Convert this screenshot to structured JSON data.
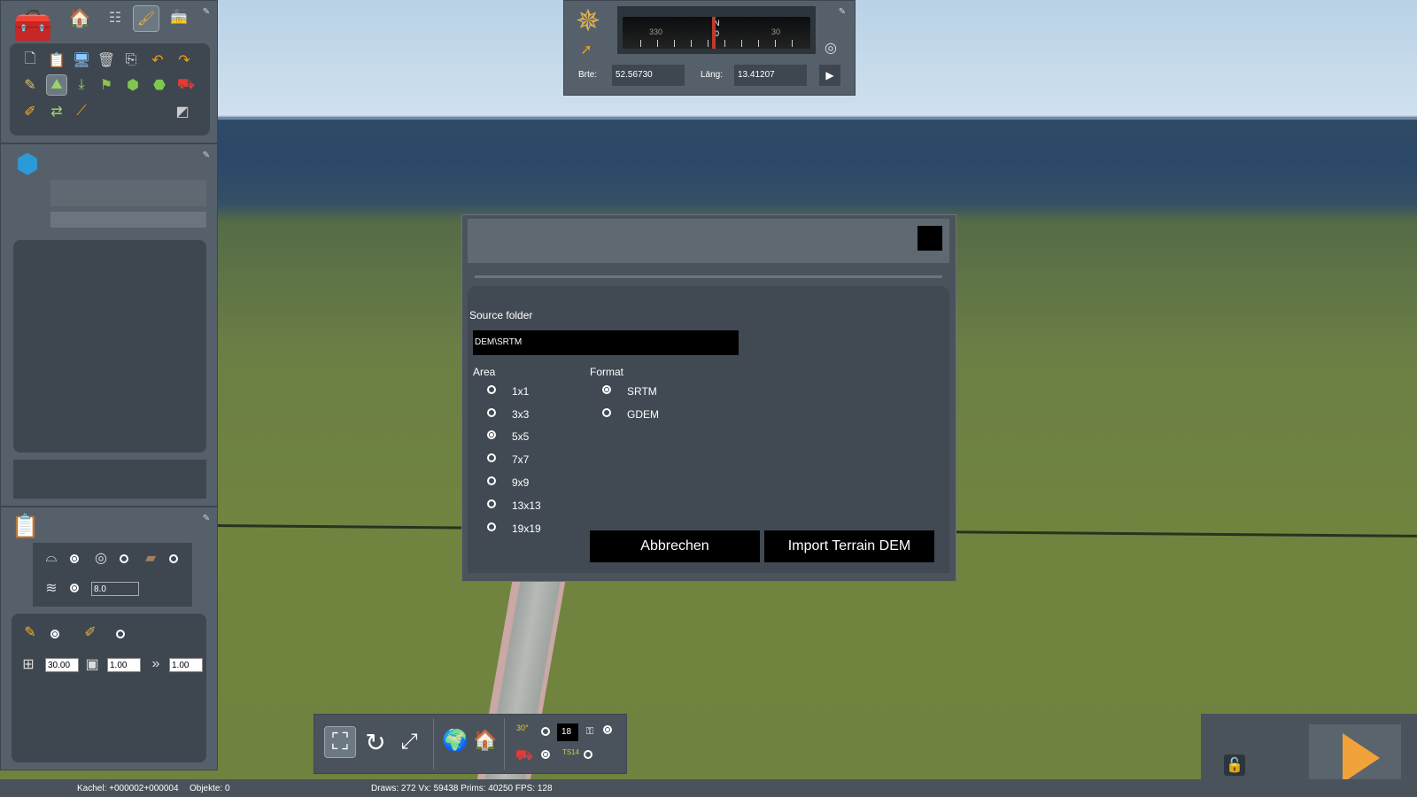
{
  "compass": {
    "ticks": [
      "330",
      "N",
      "0",
      "30"
    ],
    "lat_label": "Brte:",
    "lat_value": "52.56730",
    "lon_label": "Läng:",
    "lon_value": "13.41207"
  },
  "dialog": {
    "source_folder_label": "Source folder",
    "source_folder_value": "DEM\\SRTM",
    "area_label": "Area",
    "area_options": [
      "1x1",
      "3x3",
      "5x5",
      "7x7",
      "9x9",
      "13x13",
      "19x19"
    ],
    "area_selected": "5x5",
    "format_label": "Format",
    "format_options": [
      "SRTM",
      "GDEM"
    ],
    "format_selected": "SRTM",
    "cancel_label": "Abbrechen",
    "import_label": "Import Terrain DEM"
  },
  "brush": {
    "height_value": "8.0",
    "size_value": "30.00",
    "strength_value": "1.00",
    "falloff_value": "1.00"
  },
  "bottom_toolbar": {
    "counter_value": "18",
    "label_30": "30°",
    "label_ts": "TS14"
  },
  "status": {
    "tile_text": "Kachel: +000002+000004",
    "objects_text": "Objekte: 0",
    "stats_text": "Draws: 272 Vx: 59438 Prims: 40250 FPS: 128"
  },
  "colors": {
    "panel": "#55606a",
    "dark_panel": "#3e474f",
    "accent_play": "#f2a23a"
  }
}
